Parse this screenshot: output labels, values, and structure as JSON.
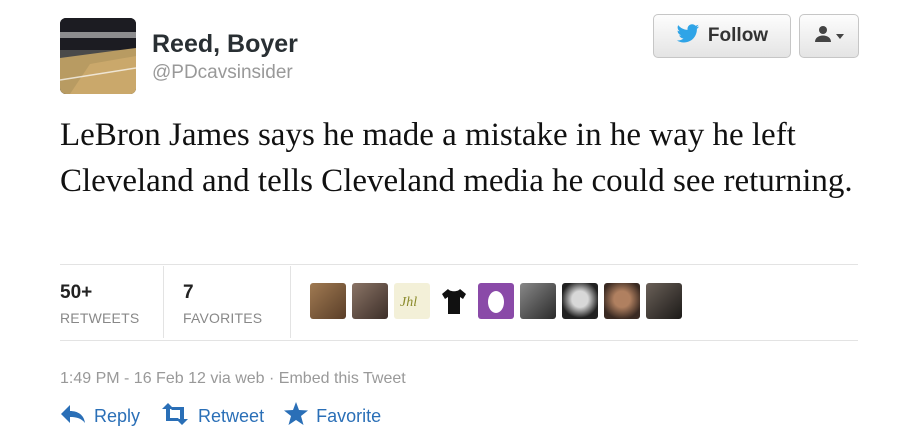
{
  "author": {
    "name": "Reed, Boyer",
    "handle": "@PDcavsinsider"
  },
  "buttons": {
    "follow_label": "Follow"
  },
  "tweet": {
    "text": "LeBron James says he made a mistake in he way he left Cleveland and tells Cleveland media he could see returning."
  },
  "stats": {
    "retweets_count": "50+",
    "retweets_label": "RETWEETS",
    "favorites_count": "7",
    "favorites_label": "FAVORITES"
  },
  "favoriters": [
    {
      "icon": "user-avatar",
      "color": "#7a5a3c"
    },
    {
      "icon": "user-avatar",
      "color": "#5c4a40"
    },
    {
      "icon": "user-avatar",
      "color": "#d8d5a8"
    },
    {
      "icon": "tshirt-icon",
      "color": "#ffffff"
    },
    {
      "icon": "egg-icon",
      "color": "#8a4aa8"
    },
    {
      "icon": "user-avatar",
      "color": "#555555"
    },
    {
      "icon": "user-avatar",
      "color": "#3c3c3c"
    },
    {
      "icon": "user-avatar",
      "color": "#6a4a3a"
    },
    {
      "icon": "user-avatar",
      "color": "#2d2a28"
    }
  ],
  "meta": {
    "time": "1:49 PM - 16 Feb 12",
    "via": "via web",
    "embed": "Embed this Tweet"
  },
  "actions": {
    "reply": "Reply",
    "retweet": "Retweet",
    "favorite": "Favorite"
  },
  "colors": {
    "link": "#2a6fb7",
    "twitter_blue": "#2fa4e7",
    "muted": "#999999"
  }
}
